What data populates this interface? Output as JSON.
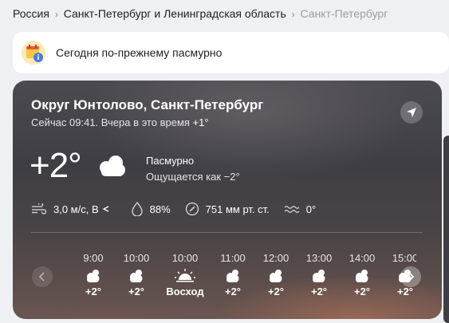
{
  "breadcrumbs": {
    "items": [
      "Россия",
      "Санкт-Петербург и Ленинградская область",
      "Санкт-Петербург"
    ],
    "separator": "›"
  },
  "notice": {
    "text": "Сегодня по-прежнему пасмурно",
    "icon": "calendar-info-icon"
  },
  "current": {
    "location": "Округ Юнтолово, Санкт-Петербург",
    "now_prefix": "Сейчас 09:41. Вчера в это время",
    "yesterday_temp": "+1°",
    "temp": "+2°",
    "condition": "Пасмурно",
    "feels_like": "Ощущается как −2°",
    "icon": "cloud-icon"
  },
  "metrics": {
    "wind": "3,0 м/с, В",
    "humidity": "88%",
    "pressure": "751 мм рт. ст.",
    "water": "0°"
  },
  "hourly": [
    {
      "time": "9:00",
      "value": "+2°",
      "icon": "sun-cloud-icon"
    },
    {
      "time": "10:00",
      "value": "+2°",
      "icon": "sun-cloud-icon"
    },
    {
      "time": "10:00",
      "value": "Восход",
      "icon": "sunrise-icon"
    },
    {
      "time": "11:00",
      "value": "+2°",
      "icon": "sun-cloud-icon"
    },
    {
      "time": "12:00",
      "value": "+2°",
      "icon": "sun-cloud-icon"
    },
    {
      "time": "13:00",
      "value": "+2°",
      "icon": "sun-cloud-icon"
    },
    {
      "time": "14:00",
      "value": "+2°",
      "icon": "sun-cloud-icon"
    },
    {
      "time": "15:00",
      "value": "+2°",
      "icon": "sun-cloud-icon"
    }
  ],
  "colors": {
    "accent_icon": "#f5c842",
    "card_bg": "#45444b",
    "page_bg": "#eef0f3"
  }
}
